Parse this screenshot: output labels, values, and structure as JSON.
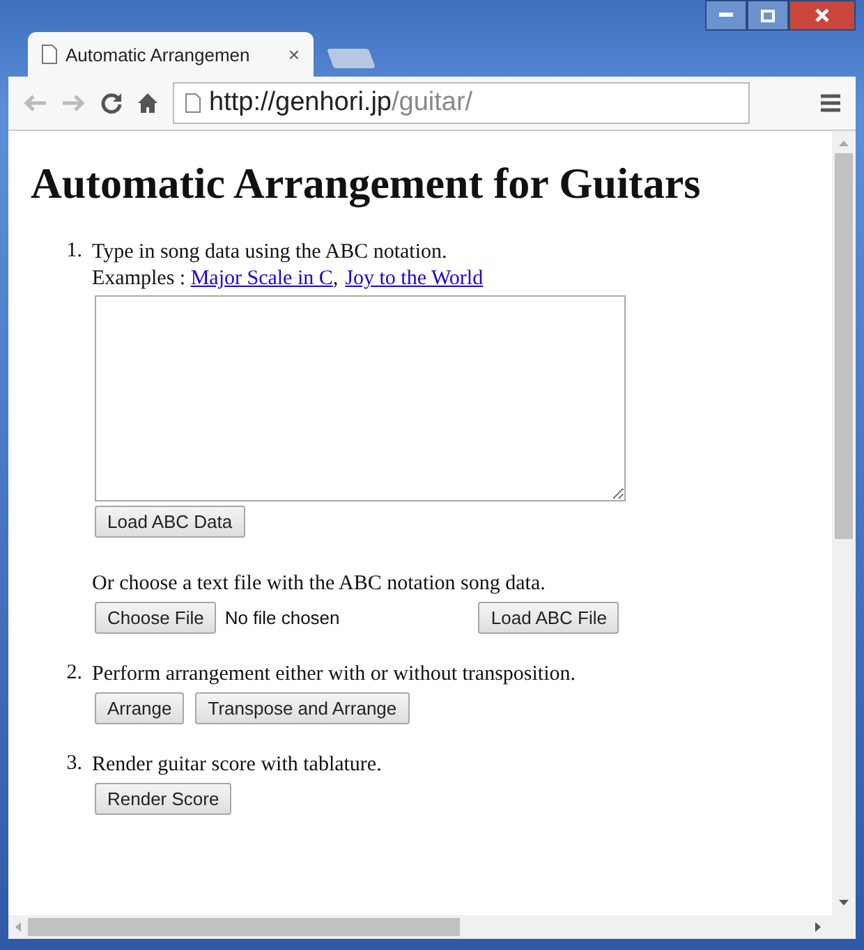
{
  "window": {
    "tab_title": "Automatic Arrangemen",
    "tab_close": "×",
    "url_host": "http://genhori.jp",
    "url_path": "/guitar/"
  },
  "heading": "Automatic Arrangement for Guitars",
  "steps": [
    {
      "number": "1.",
      "text": "Type in song data using the ABC notation.",
      "examples_label": "Examples :",
      "examples": [
        "Major Scale in C",
        "Joy to the World"
      ],
      "examples_separator": ",",
      "load_data_button": "Load ABC Data",
      "file_text": "Or choose a text file with the ABC notation song data.",
      "choose_file_button": "Choose File",
      "file_status": "No file chosen",
      "load_file_button": "Load ABC File"
    },
    {
      "number": "2.",
      "text": "Perform arrangement either with or without transposition.",
      "buttons": [
        "Arrange",
        "Transpose and Arrange"
      ]
    },
    {
      "number": "3.",
      "text": "Render guitar score with tablature.",
      "buttons": [
        "Render Score"
      ]
    }
  ]
}
